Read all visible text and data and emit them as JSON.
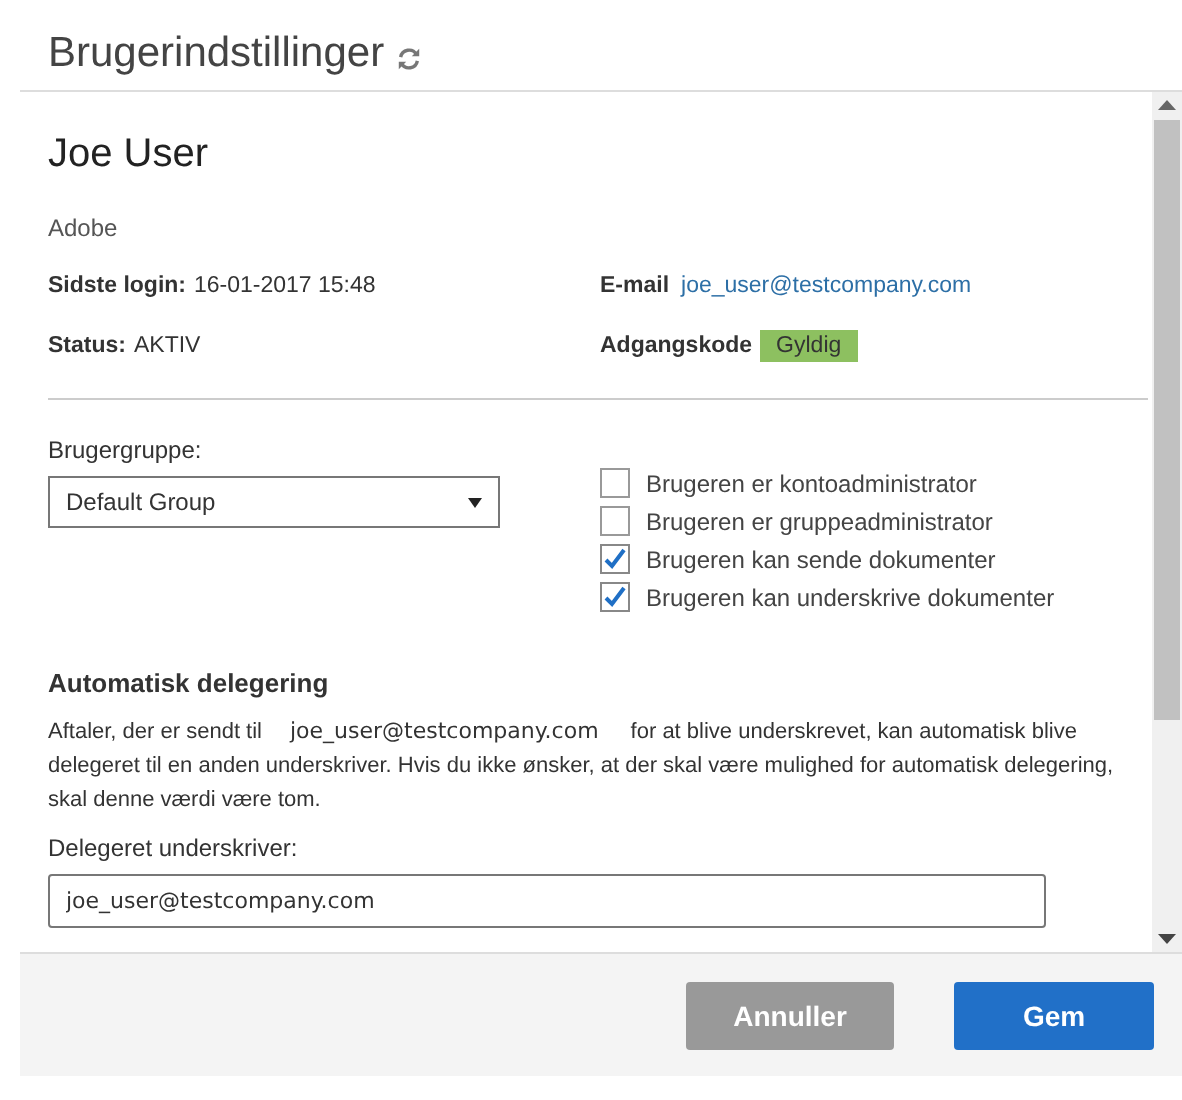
{
  "window": {
    "title": "Brugerindstillinger"
  },
  "user": {
    "name": "Joe User",
    "organization": "Adobe"
  },
  "info": {
    "last_login_label": "Sidste login:",
    "last_login": "16-01-2017 15:48",
    "email_label": "E-mail",
    "email": "joe_user@testcompany.com",
    "status_label": "Status:",
    "status": "AKTIV",
    "password_label": "Adgangskode",
    "password_status": "Gyldig"
  },
  "group": {
    "label": "Brugergruppe:",
    "value": "Default Group"
  },
  "permissions": [
    {
      "label": "Brugeren er kontoadministrator",
      "checked": false
    },
    {
      "label": "Brugeren er gruppeadministrator",
      "checked": false
    },
    {
      "label": "Brugeren kan sende dokumenter",
      "checked": true
    },
    {
      "label": "Brugeren kan underskrive dokumenter",
      "checked": true
    }
  ],
  "delegation": {
    "heading": "Automatisk delegering",
    "text_before": "Aftaler, der er sendt til",
    "email": "joe_user@testcompany.com",
    "text_after": "for at blive underskrevet, kan automatisk blive delegeret til en anden underskriver. Hvis du ikke ønsker, at der skal være mulighed for automatisk delegering, skal denne værdi være tom.",
    "field_label": "Delegeret underskriver:",
    "field_value": "joe_user@testcompany.com"
  },
  "buttons": [
    {
      "label": "Annuller",
      "kind": "secondary"
    },
    {
      "label": "Gem",
      "kind": "primary"
    }
  ]
}
